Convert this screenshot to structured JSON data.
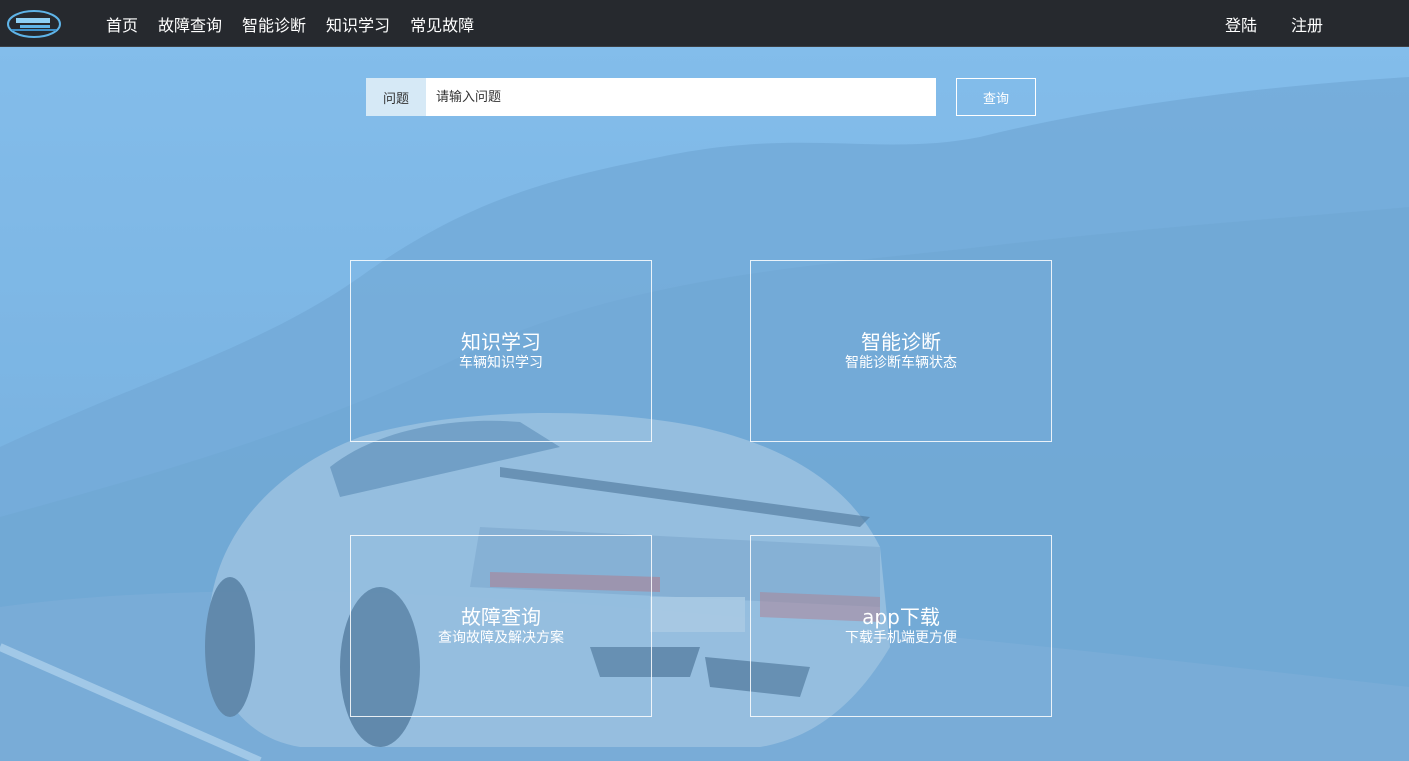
{
  "nav": {
    "links": [
      "首页",
      "故障查询",
      "智能诊断",
      "知识学习",
      "常见故障"
    ],
    "login": "登陆",
    "register": "注册"
  },
  "search": {
    "label": "问题",
    "placeholder": "请输入问题",
    "button": "查询"
  },
  "cards": [
    {
      "title": "知识学习",
      "subtitle": "车辆知识学习"
    },
    {
      "title": "智能诊断",
      "subtitle": "智能诊断车辆状态"
    },
    {
      "title": "故障查询",
      "subtitle": "查询故障及解决方案"
    },
    {
      "title": "app下载",
      "subtitle": "下载手机端更方便"
    }
  ],
  "background": {
    "sky_color": "#86c0ee",
    "hill_color": "#6a9fcb",
    "nav_color": "#26292e"
  }
}
